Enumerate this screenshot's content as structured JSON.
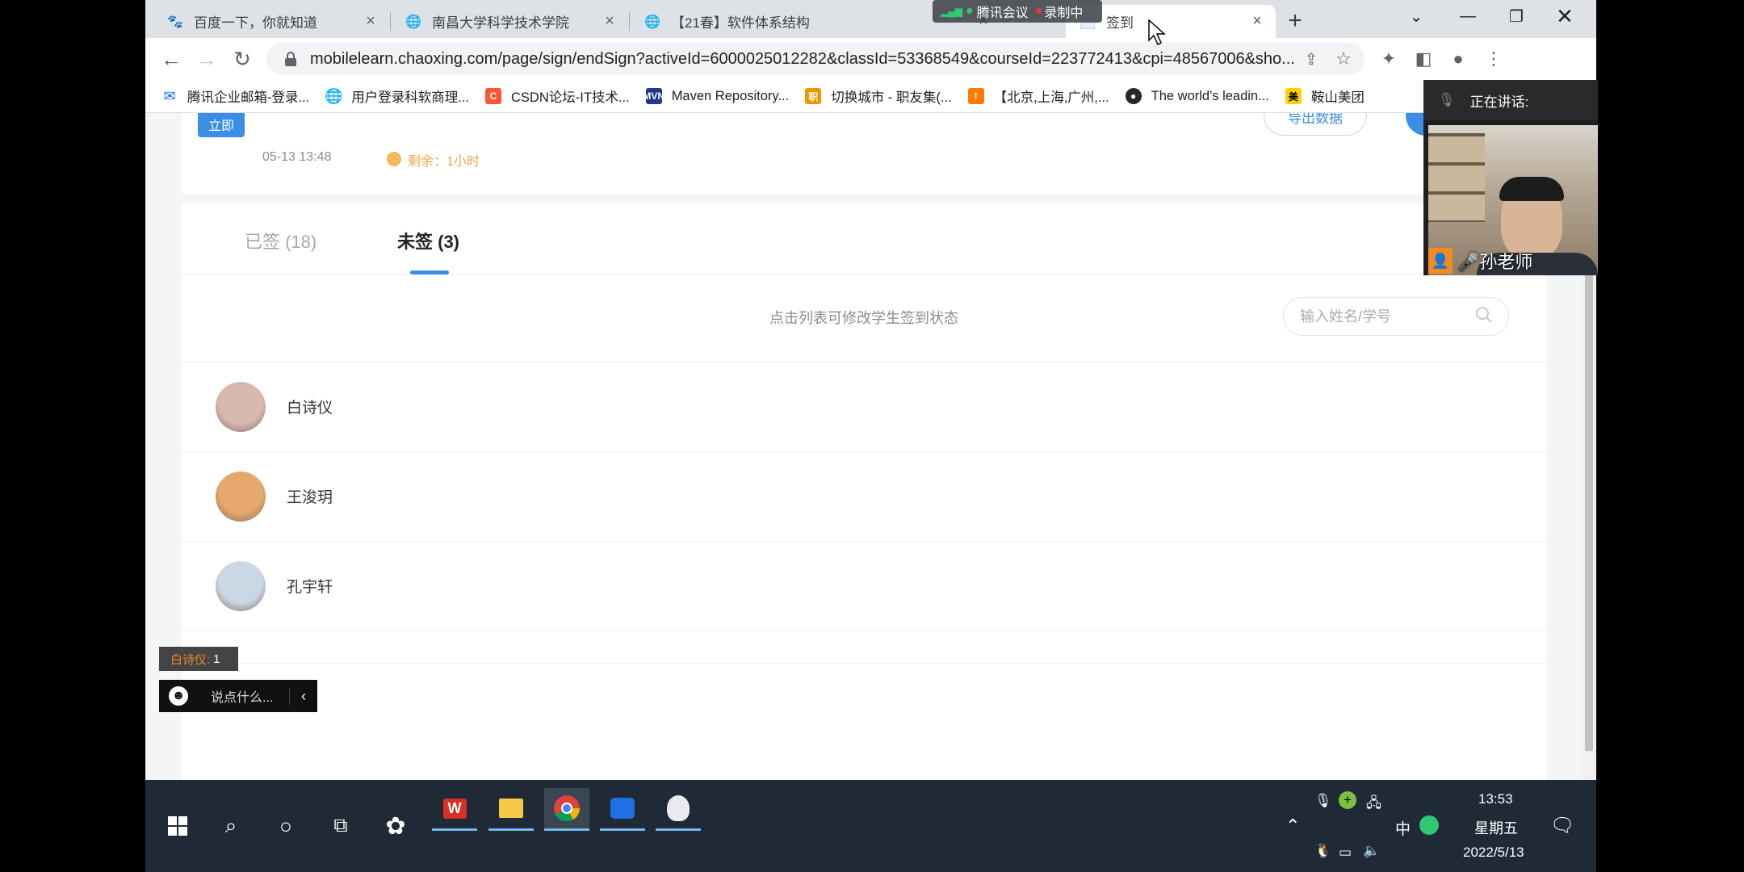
{
  "browser": {
    "tabs": [
      {
        "title": "百度一下，你就知道",
        "icon": "baidu-paw-icon"
      },
      {
        "title": "南昌大学科学技术学院",
        "icon": "globe-icon"
      },
      {
        "title": "【21春】软件体系结构",
        "icon": "globe-icon"
      },
      {
        "title": "签到",
        "icon": "page-icon",
        "active": true
      }
    ],
    "new_tab": "+",
    "url": "mobilelearn.chaoxing.com/page/sign/endSign?activeId=6000025012282&classId=53368549&courseId=223772413&cpi=48567006&sho...",
    "bookmarks": [
      {
        "label": "腾讯企业邮箱-登录...",
        "icon": "mail-icon",
        "color": "#1a73e8"
      },
      {
        "label": "用户登录科软商理...",
        "icon": "globe-icon",
        "color": "#5f6368"
      },
      {
        "label": "CSDN论坛-IT技术...",
        "icon": "csdn-icon",
        "color": "#fc5531",
        "glyph": "C"
      },
      {
        "label": "Maven Repository...",
        "icon": "maven-icon",
        "color": "#1e3a8a",
        "glyph": "MVN"
      },
      {
        "label": "切换城市 - 职友集(...",
        "icon": "zhiyouji-icon",
        "color": "#f29400",
        "glyph": "职"
      },
      {
        "label": "【北京,上海,广州,...",
        "icon": "bag-icon",
        "color": "#ff7a00",
        "glyph": "!"
      },
      {
        "label": "The world's leadin...",
        "icon": "github-icon",
        "color": "#24292f",
        "glyph": "●"
      },
      {
        "label": "鞍山美团",
        "icon": "meituan-icon",
        "color": "#ffd100",
        "glyph": "美"
      }
    ]
  },
  "meeting": {
    "app_label": "腾讯会议",
    "recording_label": "录制中",
    "speaking_label": "正在讲话:",
    "speaker_name": "孙老师"
  },
  "sign_page": {
    "top_button": "立即",
    "export_button": "导出数据",
    "datetime": "05-13 13:48",
    "remaining": "剩余：1小时",
    "tab_signed": "已签 (18)",
    "tab_unsigned": "未签 (3)",
    "hint": "点击列表可修改学生签到状态",
    "search_placeholder": "输入姓名/学号",
    "students": [
      {
        "name": "白诗仪",
        "avatar_color": "#d9b8b0"
      },
      {
        "name": "王浚玥",
        "avatar_color": "#e7a86c"
      },
      {
        "name": "孔宇轩",
        "avatar_color": "#c9d8e4"
      }
    ]
  },
  "chat": {
    "badge_name": "白诗仪:",
    "badge_count": "1",
    "input_placeholder": "说点什么..."
  },
  "taskbar": {
    "time": "13:53",
    "weekday": "星期五",
    "date": "2022/5/13",
    "ime": "中"
  },
  "colors": {
    "accent_blue": "#3a8ee6",
    "border_green": "#2ec971",
    "remaining_orange": "#f0a54a"
  }
}
